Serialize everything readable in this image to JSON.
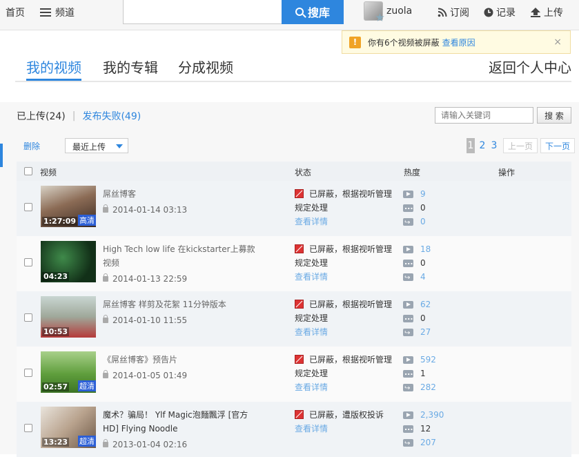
{
  "topbar": {
    "home": "首页",
    "channel": "频道",
    "search_placeholder": "",
    "search_button": "搜库",
    "username": "zuola",
    "subscribe": "订阅",
    "history": "记录",
    "upload": "上传"
  },
  "notice": {
    "text": "你有6个视频被屏蔽",
    "link": "查看原因",
    "close": "×"
  },
  "tabs": {
    "my_videos": "我的视频",
    "my_albums": "我的专辑",
    "split_videos": "分成视频",
    "back": "返回个人中心"
  },
  "subnav": {
    "uploaded": "已上传(24)",
    "separator": "|",
    "failed": "发布失败(49)"
  },
  "keyword": {
    "placeholder": "请输入关键词",
    "button": "搜 索"
  },
  "toolbar": {
    "delete": "删除",
    "sort": "最近上传"
  },
  "pager": {
    "pages": [
      "1",
      "2",
      "3"
    ],
    "current": "1",
    "prev": "上一页",
    "next": "下一页"
  },
  "table": {
    "headers": {
      "video": "视频",
      "status": "状态",
      "heat": "热度",
      "action": "操作"
    },
    "rows": [
      {
        "duration": "1:27:09",
        "quality": "高清",
        "title": "屌丝博客",
        "date": "2014-01-14 03:13",
        "status_line1": "已屏蔽，根据视听管理",
        "status_line2": "规定处理",
        "detail": "查看详情",
        "plays": "9",
        "comments": "0",
        "shares": "0"
      },
      {
        "duration": "04:23",
        "quality": "",
        "title": "High Tech low life 在kickstarter上募款视频",
        "date": "2014-01-13 22:59",
        "status_line1": "已屏蔽，根据视听管理",
        "status_line2": "规定处理",
        "detail": "查看详情",
        "plays": "18",
        "comments": "0",
        "shares": "4"
      },
      {
        "duration": "10:53",
        "quality": "",
        "title": "屌丝博客 样剪及花絮 11分钟版本",
        "date": "2014-01-10 11:55",
        "status_line1": "已屏蔽，根据视听管理",
        "status_line2": "规定处理",
        "detail": "查看详情",
        "plays": "62",
        "comments": "0",
        "shares": "27"
      },
      {
        "duration": "02:57",
        "quality": "超清",
        "title": "《屌丝博客》预告片",
        "date": "2014-01-05 01:49",
        "status_line1": "已屏蔽，根据视听管理",
        "status_line2": "规定处理",
        "detail": "查看详情",
        "plays": "592",
        "comments": "1",
        "shares": "282"
      },
      {
        "duration": "13:23",
        "quality": "超清",
        "title": "魔术？骗局！ Ylf Magic泡麵飄浮 [官方HD] Flying Noodle",
        "date": "2013-01-04 02:16",
        "status_line1": "已屏蔽，遭版权投诉",
        "status_line2": "",
        "detail": "查看详情",
        "plays": "2,390",
        "comments": "12",
        "shares": "207"
      }
    ]
  },
  "colors": {
    "accent": "#2e86de",
    "link_light": "#6aaae4",
    "blocked": "#d33",
    "notice_bg": "#fffbe2"
  }
}
